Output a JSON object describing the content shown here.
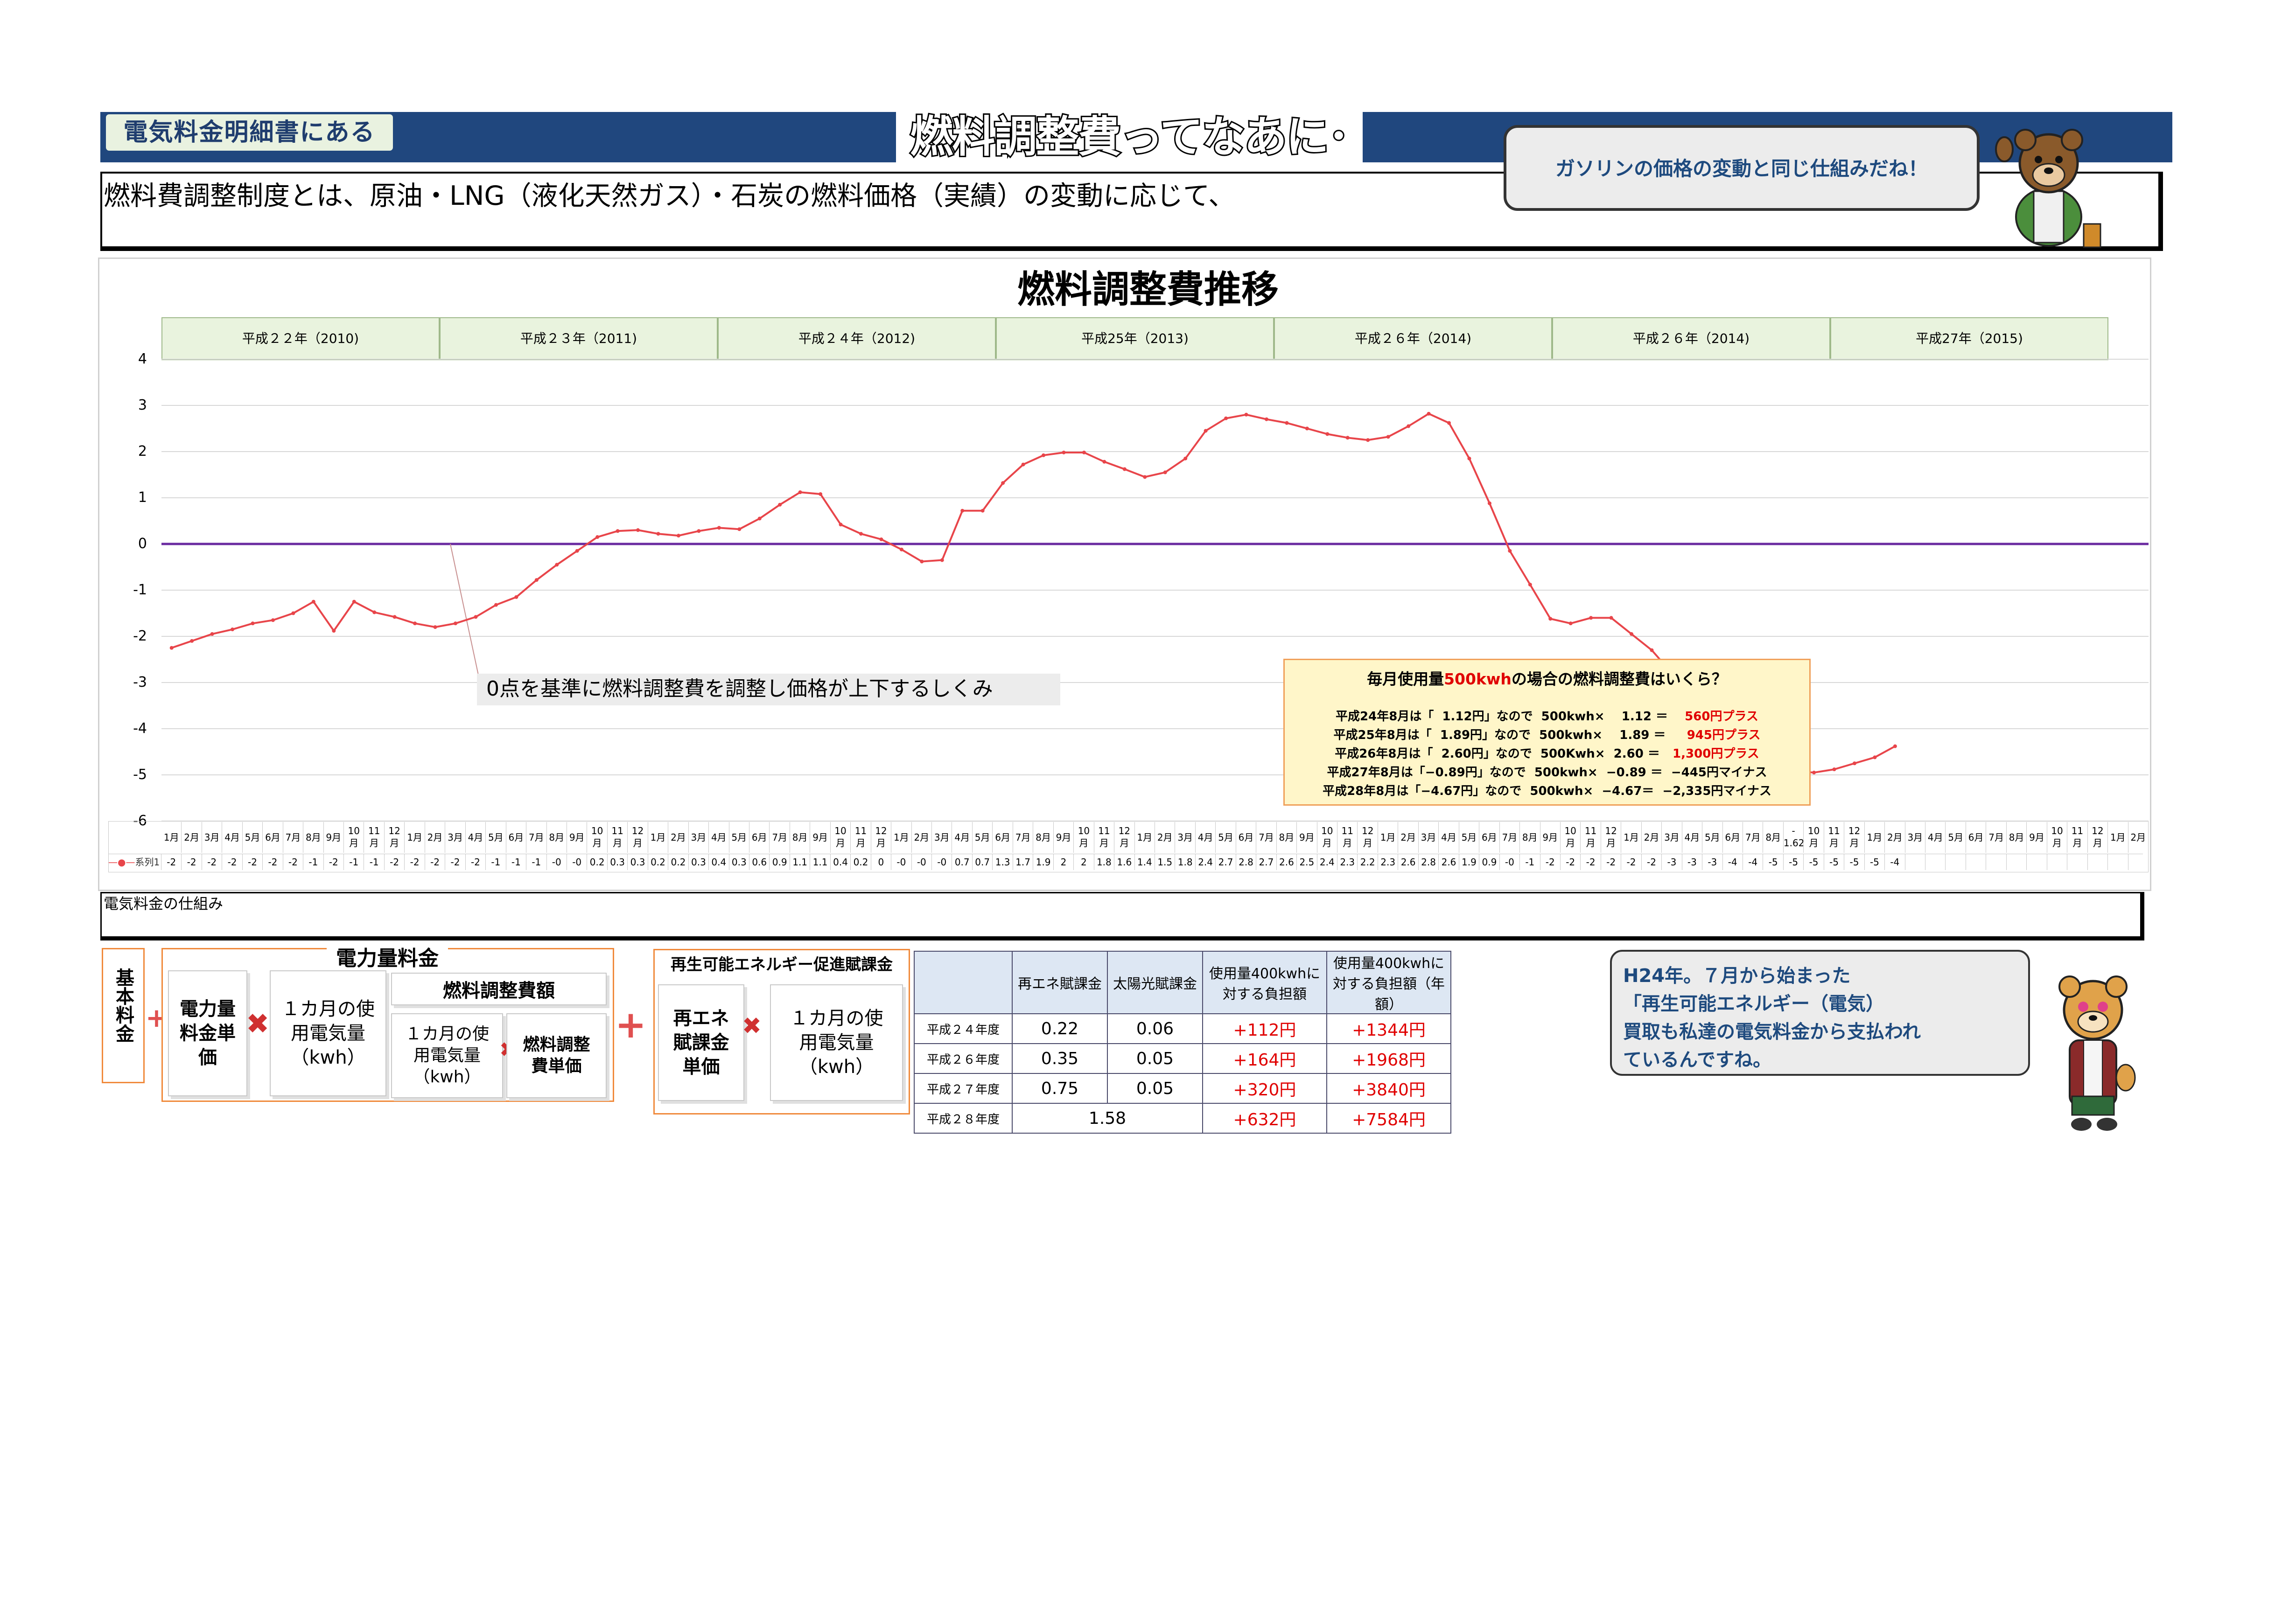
{
  "header": {
    "tag": "電気料金明細書にある",
    "title": "燃料調整費ってなあに･",
    "intro": "燃料費調整制度とは、原油・LNG（液化天然ガス）・石炭の燃料価格（実績）の変動に応じて、",
    "bubble": "ガソリンの価格の変動と同じ仕組みだね！"
  },
  "chart_data": {
    "type": "line",
    "title": "燃料調整費推移",
    "eras": [
      "平成２２年（2010)",
      "平成２３年（2011)",
      "平成２４年（2012)",
      "平成25年（2013)",
      "平成２６年（2014)",
      "平成２６年（2014)",
      "平成27年（2015)"
    ],
    "ylim": [
      -6,
      4
    ],
    "yticks": [
      "4",
      "3",
      "2",
      "1",
      "0",
      "-1",
      "-2",
      "-3",
      "-4",
      "-5",
      "-6"
    ],
    "categories": [
      "1月",
      "2月",
      "3月",
      "4月",
      "5月",
      "6月",
      "7月",
      "8月",
      "9月",
      "10\n月",
      "11\n月",
      "12\n月",
      "1月",
      "2月",
      "3月",
      "4月",
      "5月",
      "6月",
      "7月",
      "8月",
      "9月",
      "10\n月",
      "11\n月",
      "12\n月",
      "1月",
      "2月",
      "3月",
      "4月",
      "5月",
      "6月",
      "7月",
      "8月",
      "9月",
      "10\n月",
      "11\n月",
      "12\n月",
      "1月",
      "2月",
      "3月",
      "4月",
      "5月",
      "6月",
      "7月",
      "8月",
      "9月",
      "10\n月",
      "11\n月",
      "12\n月",
      "1月",
      "2月",
      "3月",
      "4月",
      "5月",
      "6月",
      "7月",
      "8月",
      "9月",
      "10\n月",
      "11\n月",
      "12\n月",
      "1月",
      "2月",
      "3月",
      "4月",
      "5月",
      "6月",
      "7月",
      "8月",
      "9月",
      "10\n月",
      "11\n月",
      "12\n月",
      "1月",
      "2月",
      "3月",
      "4月",
      "5月",
      "6月",
      "7月",
      "8月",
      "-\n1.62",
      "10\n月",
      "11\n月",
      "12\n月",
      "1月",
      "2月",
      "3月",
      "4月",
      "5月",
      "6月",
      "7月",
      "8月",
      "9月",
      "10\n月",
      "11\n月",
      "12\n月",
      "1月",
      "2月"
    ],
    "series": [
      {
        "name": "系列1",
        "color": "#e8454a",
        "values": [
          -2.25,
          -2.1,
          -1.95,
          -1.85,
          -1.72,
          -1.65,
          -1.5,
          -1.25,
          -1.88,
          -1.25,
          -1.48,
          -1.58,
          -1.72,
          -1.8,
          -1.72,
          -1.58,
          -1.32,
          -1.15,
          -0.78,
          -0.45,
          -0.15,
          0.15,
          0.28,
          0.3,
          0.22,
          0.18,
          0.28,
          0.35,
          0.32,
          0.55,
          0.85,
          1.12,
          1.08,
          0.42,
          0.22,
          0.1,
          -0.12,
          -0.38,
          -0.35,
          0.72,
          0.72,
          1.32,
          1.72,
          1.92,
          1.98,
          1.98,
          1.78,
          1.62,
          1.45,
          1.55,
          1.85,
          2.45,
          2.72,
          2.8,
          2.7,
          2.62,
          2.5,
          2.38,
          2.3,
          2.25,
          2.32,
          2.55,
          2.82,
          2.62,
          1.85,
          0.88,
          -0.15,
          -0.88,
          -1.62,
          -1.72,
          -1.6,
          -1.6,
          -1.95,
          -2.3,
          -2.8,
          -3.3,
          -3.3,
          -3.88,
          -4.28,
          -4.65,
          -4.92,
          -4.95,
          -4.88,
          -4.75,
          -4.62,
          -4.38
        ],
        "labels": [
          "-2",
          "-2",
          "-2",
          "-2",
          "-2",
          "-2",
          "-2",
          "-1",
          "-2",
          "-1",
          "-1",
          "-2",
          "-2",
          "-2",
          "-2",
          "-2",
          "-1",
          "-1",
          "-1",
          "-0",
          "-0",
          "0.2",
          "0.3",
          "0.3",
          "0.2",
          "0.2",
          "0.3",
          "0.4",
          "0.3",
          "0.6",
          "0.9",
          "1.1",
          "1.1",
          "0.4",
          "0.2",
          "0",
          "-0",
          "-0",
          "-0",
          "0.7",
          "0.7",
          "1.3",
          "1.7",
          "1.9",
          "2",
          "2",
          "1.8",
          "1.6",
          "1.4",
          "1.5",
          "1.8",
          "2.4",
          "2.7",
          "2.8",
          "2.7",
          "2.6",
          "2.5",
          "2.4",
          "2.3",
          "2.2",
          "2.3",
          "2.6",
          "2.8",
          "2.6",
          "1.9",
          "0.9",
          "-0",
          "-1",
          "-2",
          "-2",
          "-2",
          "-2",
          "-2",
          "-2",
          "-3",
          "-3",
          "-3",
          "-4",
          "-4",
          "-5",
          "-5",
          "-5",
          "-5",
          "-5",
          "-5",
          "-4"
        ]
      }
    ],
    "annotation": "0点を基準に燃料調整費を調整し価格が上下するしくみ",
    "info": {
      "title_pre": "毎月使用量",
      "title_red": "500kwh",
      "title_post": "の場合の燃料調整費はいくら？",
      "lines": [
        {
          "text": "平成24年8月は「  1.12円」なので  500kwh×    1.12 ＝    ",
          "red": "560円プラス",
          "tail": ""
        },
        {
          "text": "平成25年8月は「  1.89円」なので  500kwh×    1.89 ＝     ",
          "red": "945円プラス",
          "tail": ""
        },
        {
          "text": "平成26年8月は「  2.60円」なので  500Kwh×  2.60 ＝   ",
          "red": "1,300円プラス",
          "tail": ""
        },
        {
          "text": "平成27年8月は「−0.89円」なので  500kwh×  −0.89 ＝  −445円マイナス",
          "red": "",
          "tail": ""
        },
        {
          "text": "平成28年8月は「−4.67円」なので  500kwh×  −4.67＝  −2,335円マイナス",
          "red": "",
          "tail": ""
        }
      ]
    }
  },
  "lower": {
    "section_label": "電気料金の仕組み",
    "base_fee": "基本料金",
    "power_fee_title": "電力量料金",
    "unit_price": "電力量料金単価",
    "monthly_usage": "１カ月の使用電気量（kwh）",
    "fuel_adj_title": "燃料調整費額",
    "fuel_usage": "１カ月の使用電気量（kwh）",
    "fuel_unit": "燃料調整費単価",
    "renew_title": "再生可能エネルギー促進賦課金",
    "renew_unit": "再エネ賦課金単価",
    "renew_usage": "１カ月の使用電気量（kwh）"
  },
  "renew_table": {
    "headers": [
      "",
      "再エネ賦課金",
      "太陽光賦課金",
      "使用量400kwhに対する負担額",
      "使用量400kwhに対する負担額（年額）"
    ],
    "rows": [
      [
        "平成２４年度",
        "0.22",
        "0.06",
        "+112円",
        "+1344円"
      ],
      [
        "平成２６年度",
        "0.35",
        "0.05",
        "+164円",
        "+1968円"
      ],
      [
        "平成２７年度",
        "0.75",
        "0.05",
        "+320円",
        "+3840円"
      ],
      [
        "平成２８年度",
        "1.58",
        "",
        "+632円",
        "+7584円"
      ]
    ]
  },
  "bubble2": "H24年。７月から始まった\n「再生可能エネルギー（電気）\n買取も私達の電気料金から支払われ\nているんですね。"
}
